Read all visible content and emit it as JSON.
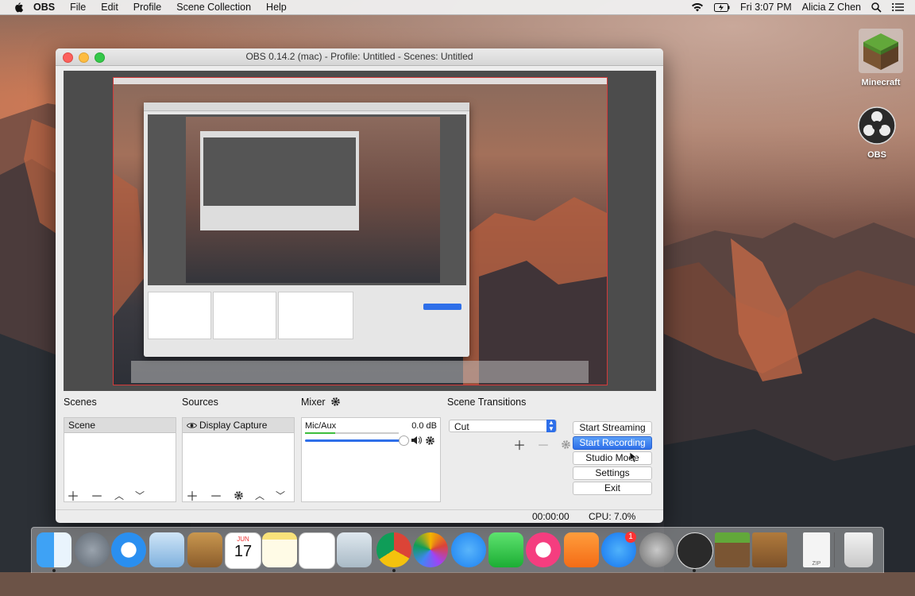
{
  "menubar": {
    "items": [
      {
        "label": "OBS",
        "app": true
      },
      {
        "label": "File"
      },
      {
        "label": "Edit"
      },
      {
        "label": "Profile"
      },
      {
        "label": "Scene Collection"
      },
      {
        "label": "Help"
      }
    ],
    "clock": "Fri 3:07 PM",
    "user": "Alicia Z Chen"
  },
  "desktop_icons": [
    {
      "label": "Minecraft",
      "icon": "minecraft-icon"
    },
    {
      "label": "OBS",
      "icon": "obs-icon"
    }
  ],
  "window": {
    "title": "OBS 0.14.2 (mac) - Profile: Untitled - Scenes: Untitled"
  },
  "panels": {
    "scenes": {
      "label": "Scenes",
      "items": [
        "Scene"
      ]
    },
    "sources": {
      "label": "Sources",
      "items": [
        "Display Capture"
      ]
    },
    "mixer": {
      "label": "Mixer",
      "channel": "Mic/Aux",
      "level": "0.0 dB"
    },
    "transitions": {
      "label": "Scene Transitions",
      "selected": "Cut"
    }
  },
  "controls": {
    "start_streaming": "Start Streaming",
    "start_recording": "Start Recording",
    "studio_mode": "Studio Mode",
    "settings": "Settings",
    "exit": "Exit"
  },
  "status": {
    "time": "00:00:00",
    "cpu": "CPU: 7.0%"
  },
  "dock": {
    "items": [
      "finder-icon",
      "launchpad-icon",
      "safari-icon",
      "mail-icon",
      "contacts-icon",
      "calendar-icon",
      "notes-icon",
      "reminders-icon",
      "preview-icon",
      "chrome-icon",
      "photos-icon",
      "messages-icon",
      "facetime-icon",
      "itunes-icon",
      "ibooks-icon",
      "app-store-icon",
      "system-preferences-icon",
      "obs-icon",
      "minecraft-icon",
      "crafting-table-icon",
      "zip-file-icon",
      "trash-icon"
    ],
    "calendar_month": "JUN",
    "calendar_day": "17",
    "app_store_badge": "1",
    "zip_label": "ZIP"
  },
  "colors": {
    "accent": "#2e6fe9",
    "record_button": "#2e6fe9",
    "preview_border": "#d43a3a"
  }
}
